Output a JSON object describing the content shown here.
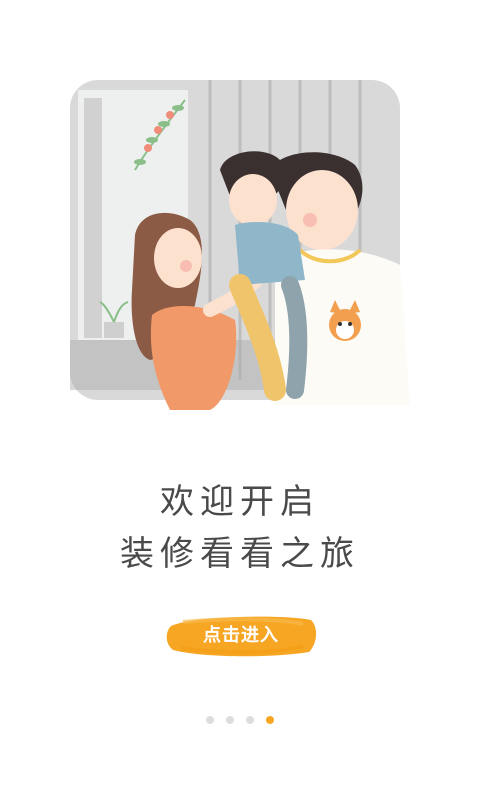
{
  "welcome": {
    "line1": "欢迎开启",
    "line2": "装修看看之旅"
  },
  "enter_button": {
    "label": "点击进入"
  },
  "pager": {
    "total": 4,
    "active_index": 3
  },
  "colors": {
    "accent": "#f6a623",
    "text": "#4a4a4a",
    "dot_inactive": "#dddddd"
  },
  "illustration": {
    "subject": "family-illustration"
  }
}
